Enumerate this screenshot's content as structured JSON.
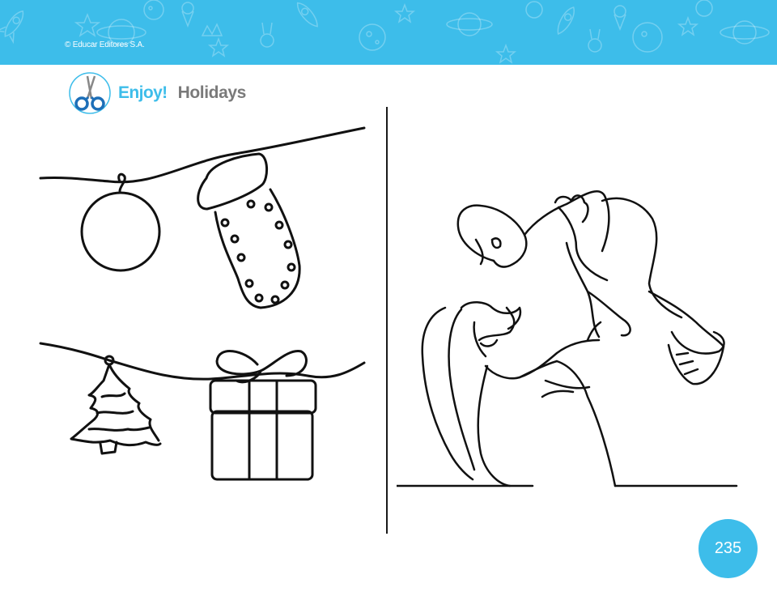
{
  "banner": {
    "copyright": "© Educar Editores S.A.",
    "color": "#3dbdea",
    "pattern_icons": [
      "rocket-icon",
      "planet-icon",
      "star-icon",
      "bunny-icon",
      "ice-cream-icon",
      "crown-icon",
      "moon-icon"
    ]
  },
  "header": {
    "icon": "scissors-icon",
    "title_primary": "Enjoy!",
    "title_secondary": "Holidays",
    "primary_color": "#3dbdea",
    "secondary_color": "#7a7a7a"
  },
  "left_panel": {
    "drawings": [
      "ornament-ball",
      "christmas-stocking",
      "christmas-tree",
      "gift-box"
    ]
  },
  "right_panel": {
    "drawings": [
      "mother-lifting-child"
    ]
  },
  "footer": {
    "page_number": "235",
    "badge_color": "#3dbdea"
  }
}
